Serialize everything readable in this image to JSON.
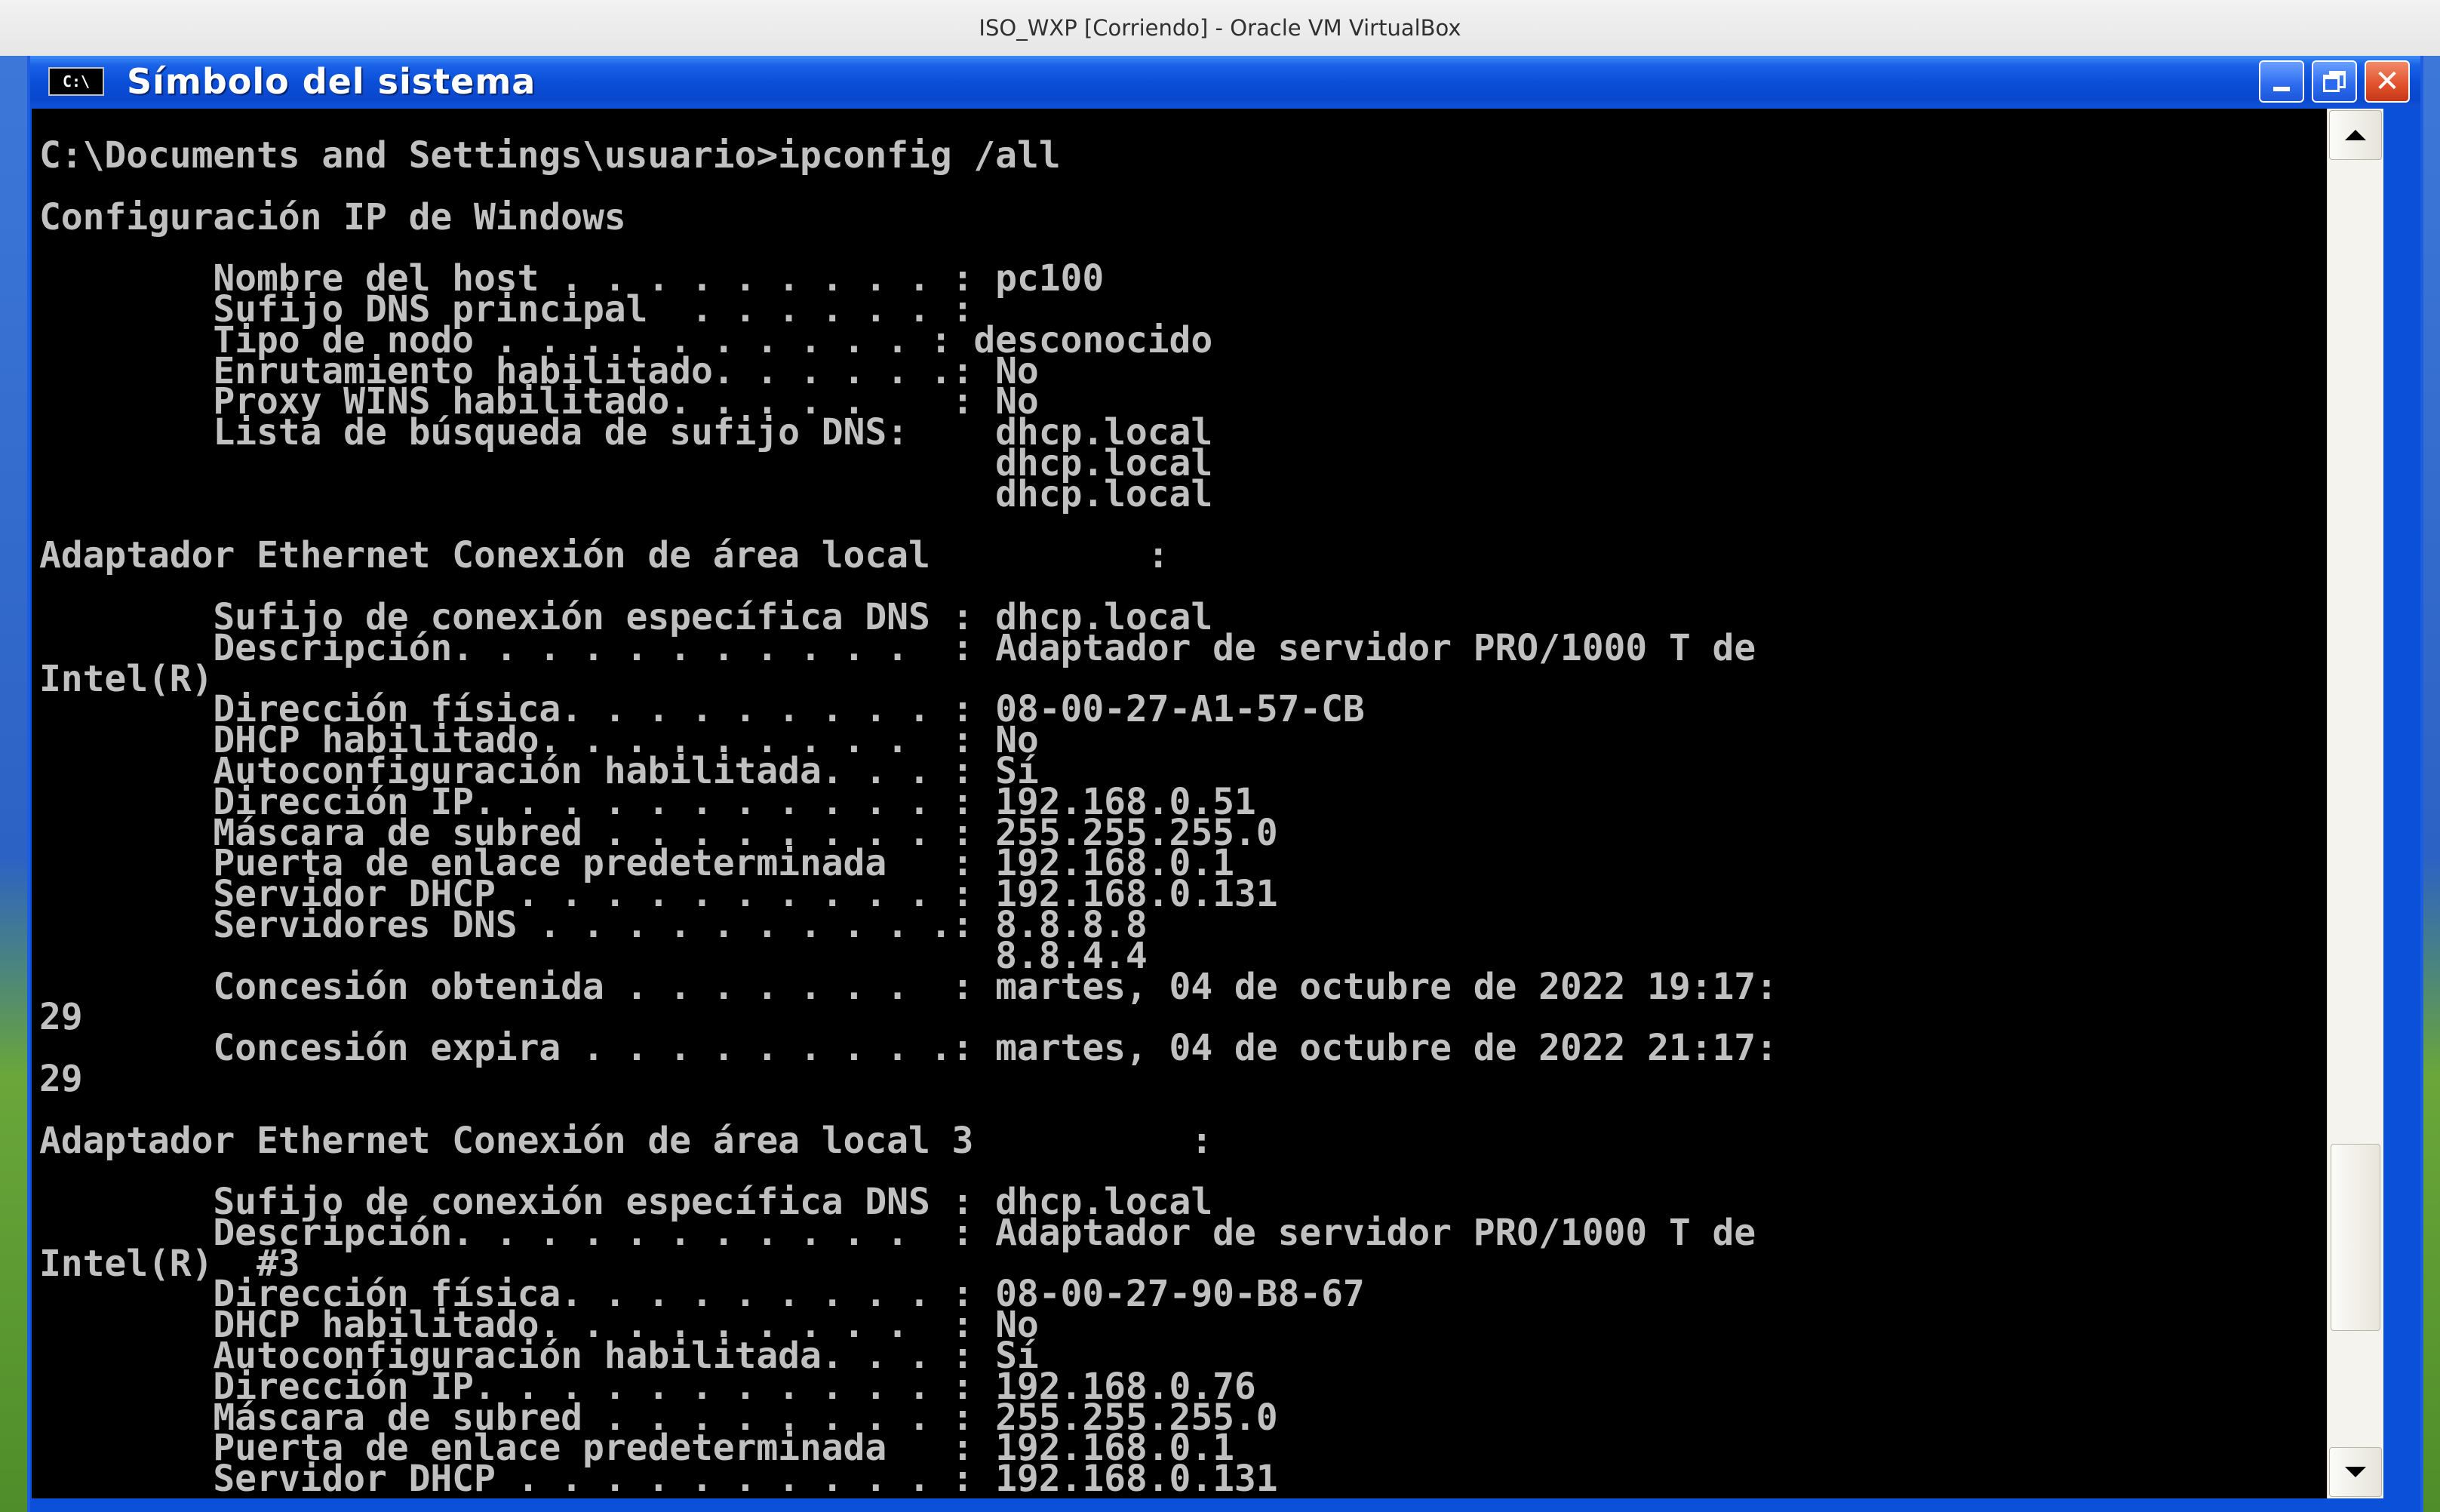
{
  "host": {
    "window_title": "ISO_WXP [Corriendo] - Oracle VM VirtualBox"
  },
  "window": {
    "title": "Símbolo del sistema",
    "icon": "cmd-icon",
    "icon_text": "C:\\",
    "controls": [
      "minimize-icon",
      "restore-icon",
      "close-icon"
    ]
  },
  "console": {
    "text": "C:\\Documents and Settings\\usuario>ipconfig /all\n\nConfiguración IP de Windows\n\n        Nombre del host . . . . . . . . . : pc100\n        Sufijo DNS principal  . . . . . . :\n        Tipo de nodo . . . . . . . . . . : desconocido\n        Enrutamiento habilitado. . . . . .: No\n        Proxy WINS habilitado. . . . .    : No\n        Lista de búsqueda de sufijo DNS:    dhcp.local\n                                            dhcp.local\n                                            dhcp.local\n\nAdaptador Ethernet Conexión de área local          :\n\n        Sufijo de conexión específica DNS : dhcp.local\n        Descripción. . . . . . . . . . .  : Adaptador de servidor PRO/1000 T de\nIntel(R)\n        Dirección física. . . . . . . . . : 08-00-27-A1-57-CB\n        DHCP habilitado. . . . . . . . .  : No\n        Autoconfiguración habilitada. . . : Sí\n        Dirección IP. . . . . . . . . . . : 192.168.0.51\n        Máscara de subred . . . . . . . . : 255.255.255.0\n        Puerta de enlace predeterminada   : 192.168.0.1\n        Servidor DHCP . . . . . . . . . . : 192.168.0.131\n        Servidores DNS . . . . . . . . . .: 8.8.8.8\n                                            8.8.4.4\n        Concesión obtenida . . . . . . .  : martes, 04 de octubre de 2022 19:17:\n29\n        Concesión expira . . . . . . . . .: martes, 04 de octubre de 2022 21:17:\n29\n\nAdaptador Ethernet Conexión de área local 3          :\n\n        Sufijo de conexión específica DNS : dhcp.local\n        Descripción. . . . . . . . . . .  : Adaptador de servidor PRO/1000 T de\nIntel(R)  #3\n        Dirección física. . . . . . . . . : 08-00-27-90-B8-67\n        DHCP habilitado. . . . . . . . .  : No\n        Autoconfiguración habilitada. . . : Sí\n        Dirección IP. . . . . . . . . . . : 192.168.0.76\n        Máscara de subred . . . . . . . . : 255.255.255.0\n        Puerta de enlace predeterminada   : 192.168.0.1\n        Servidor DHCP . . . . . . . . . . : 192.168.0.131"
  },
  "scrollbar": {
    "up_icon": "scroll-up-arrow-icon",
    "down_icon": "scroll-down-arrow-icon"
  }
}
